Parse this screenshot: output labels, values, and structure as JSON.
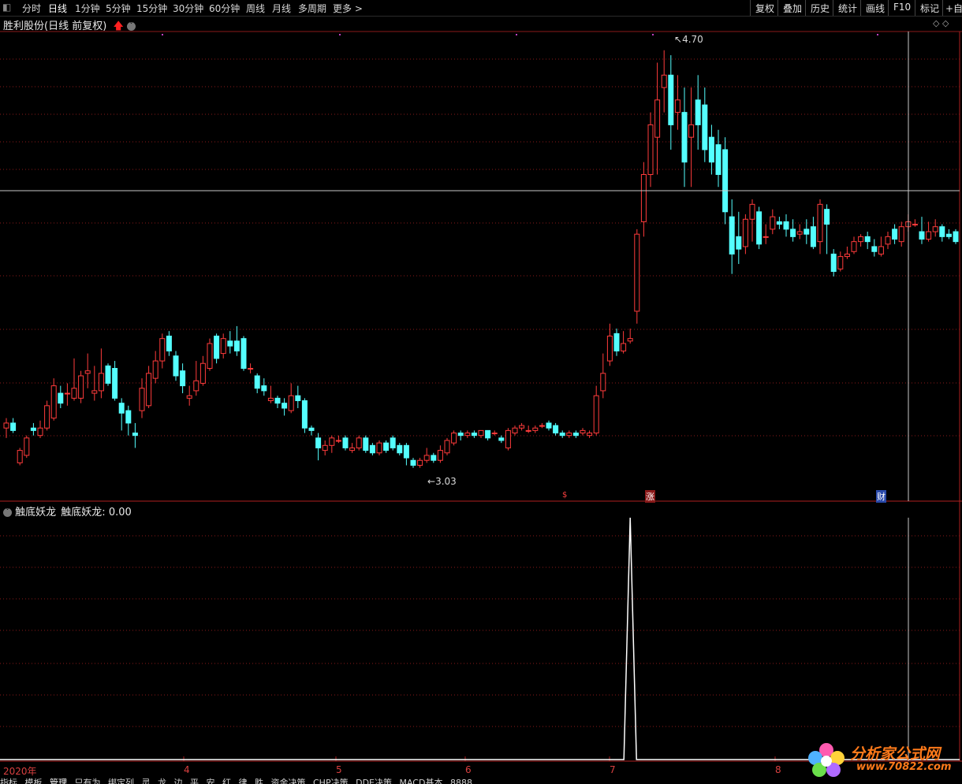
{
  "toolbar": {
    "periods": [
      "分时",
      "日线",
      "1分钟",
      "5分钟",
      "15分钟",
      "30分钟",
      "60分钟",
      "周线",
      "月线",
      "多周期",
      "更多 >"
    ],
    "active_period": "日线",
    "right_buttons": [
      "复权",
      "叠加",
      "历史",
      "统计",
      "画线",
      "F10",
      "标记",
      "+自"
    ]
  },
  "stock": {
    "name": "胜利股份",
    "mode": "(日线 前复权)"
  },
  "price_labels": {
    "high": "4.70",
    "low": "3.03"
  },
  "event_markers": [
    "$",
    "涨",
    "财"
  ],
  "indicator": {
    "title": "触底妖龙",
    "label": "触底妖龙:",
    "value": "0.00"
  },
  "date_axis": [
    "2020年",
    "4",
    "5",
    "6",
    "7",
    "8"
  ],
  "bottom_tabs": [
    "指标",
    "模板",
    "管理",
    "只有为",
    "绑定列",
    "灵",
    "龙",
    "边",
    "平",
    "安",
    "红",
    "律",
    "胜",
    "资金决策",
    "CHP决策",
    "DDE决策",
    "MACD基本",
    "8888"
  ],
  "watermark": {
    "site": "分析家公式网",
    "url": "www.70822.com"
  },
  "colors": {
    "up": "#ff3b3b",
    "down": "#54ffff",
    "grid": "#8a1a1a",
    "text": "#c0c0c0"
  },
  "chart_data": {
    "type": "candlestick",
    "series_name": "胜利股份",
    "ylim": [
      3.0,
      4.75
    ],
    "high_label": 4.7,
    "low_label": 3.03,
    "candles": [
      [
        3.18,
        3.2,
        3.14,
        3.22
      ],
      [
        3.2,
        3.17,
        3.16,
        3.22
      ],
      [
        3.04,
        3.09,
        3.03,
        3.1
      ],
      [
        3.07,
        3.14,
        3.06,
        3.15
      ],
      [
        3.18,
        3.17,
        3.15,
        3.2
      ],
      [
        3.15,
        3.18,
        3.14,
        3.21
      ],
      [
        3.18,
        3.27,
        3.17,
        3.29
      ],
      [
        3.22,
        3.35,
        3.21,
        3.38
      ],
      [
        3.32,
        3.28,
        3.26,
        3.35
      ],
      [
        3.32,
        3.32,
        3.27,
        3.36
      ],
      [
        3.3,
        3.34,
        3.29,
        3.46
      ],
      [
        3.3,
        3.39,
        3.28,
        3.41
      ],
      [
        3.4,
        3.41,
        3.34,
        3.48
      ],
      [
        3.32,
        3.33,
        3.29,
        3.43
      ],
      [
        3.33,
        3.4,
        3.3,
        3.5
      ],
      [
        3.43,
        3.36,
        3.35,
        3.44
      ],
      [
        3.42,
        3.3,
        3.29,
        3.45
      ],
      [
        3.28,
        3.24,
        3.17,
        3.3
      ],
      [
        3.25,
        3.2,
        3.15,
        3.27
      ],
      [
        3.16,
        3.15,
        3.1,
        3.2
      ],
      [
        3.25,
        3.34,
        3.22,
        3.38
      ],
      [
        3.27,
        3.4,
        3.26,
        3.43
      ],
      [
        3.38,
        3.45,
        3.36,
        3.49
      ],
      [
        3.45,
        3.54,
        3.42,
        3.56
      ],
      [
        3.55,
        3.49,
        3.47,
        3.57
      ],
      [
        3.47,
        3.39,
        3.37,
        3.49
      ],
      [
        3.41,
        3.35,
        3.32,
        3.44
      ],
      [
        3.3,
        3.31,
        3.27,
        3.35
      ],
      [
        3.33,
        3.37,
        3.31,
        3.45
      ],
      [
        3.36,
        3.44,
        3.35,
        3.47
      ],
      [
        3.42,
        3.52,
        3.41,
        3.54
      ],
      [
        3.55,
        3.46,
        3.44,
        3.56
      ],
      [
        3.48,
        3.54,
        3.46,
        3.56
      ],
      [
        3.53,
        3.51,
        3.48,
        3.57
      ],
      [
        3.53,
        3.49,
        3.47,
        3.59
      ],
      [
        3.54,
        3.42,
        3.41,
        3.55
      ],
      [
        3.42,
        3.42,
        3.4,
        3.44
      ],
      [
        3.39,
        3.34,
        3.32,
        3.4
      ],
      [
        3.35,
        3.33,
        3.31,
        3.38
      ],
      [
        3.29,
        3.3,
        3.28,
        3.35
      ],
      [
        3.3,
        3.28,
        3.26,
        3.31
      ],
      [
        3.28,
        3.26,
        3.23,
        3.3
      ],
      [
        3.25,
        3.31,
        3.24,
        3.36
      ],
      [
        3.31,
        3.29,
        3.26,
        3.35
      ],
      [
        3.29,
        3.18,
        3.16,
        3.3
      ],
      [
        3.18,
        3.17,
        3.15,
        3.19
      ],
      [
        3.14,
        3.1,
        3.05,
        3.16
      ],
      [
        3.09,
        3.11,
        3.07,
        3.13
      ],
      [
        3.11,
        3.14,
        3.08,
        3.15
      ],
      [
        3.13,
        3.13,
        3.12,
        3.15
      ],
      [
        3.14,
        3.1,
        3.09,
        3.15
      ],
      [
        3.09,
        3.1,
        3.08,
        3.12
      ],
      [
        3.1,
        3.14,
        3.09,
        3.15
      ],
      [
        3.14,
        3.09,
        3.08,
        3.15
      ],
      [
        3.11,
        3.08,
        3.07,
        3.12
      ],
      [
        3.08,
        3.12,
        3.07,
        3.13
      ],
      [
        3.12,
        3.09,
        3.08,
        3.13
      ],
      [
        3.14,
        3.1,
        3.09,
        3.15
      ],
      [
        3.11,
        3.08,
        3.07,
        3.12
      ],
      [
        3.11,
        3.06,
        3.03,
        3.12
      ],
      [
        3.05,
        3.03,
        3.02,
        3.06
      ],
      [
        3.03,
        3.05,
        3.02,
        3.06
      ],
      [
        3.05,
        3.07,
        3.04,
        3.1
      ],
      [
        3.07,
        3.05,
        3.04,
        3.08
      ],
      [
        3.05,
        3.09,
        3.04,
        3.11
      ],
      [
        3.08,
        3.13,
        3.07,
        3.14
      ],
      [
        3.12,
        3.16,
        3.11,
        3.17
      ],
      [
        3.16,
        3.15,
        3.13,
        3.17
      ],
      [
        3.15,
        3.16,
        3.14,
        3.17
      ],
      [
        3.16,
        3.15,
        3.14,
        3.17
      ],
      [
        3.15,
        3.17,
        3.14,
        3.17
      ],
      [
        3.17,
        3.14,
        3.13,
        3.17
      ],
      [
        3.16,
        3.16,
        3.15,
        3.17
      ],
      [
        3.14,
        3.13,
        3.12,
        3.15
      ],
      [
        3.1,
        3.17,
        3.09,
        3.18
      ],
      [
        3.16,
        3.18,
        3.15,
        3.19
      ],
      [
        3.18,
        3.19,
        3.17,
        3.2
      ],
      [
        3.17,
        3.17,
        3.16,
        3.19
      ],
      [
        3.17,
        3.18,
        3.16,
        3.19
      ],
      [
        3.19,
        3.19,
        3.18,
        3.2
      ],
      [
        3.2,
        3.18,
        3.17,
        3.21
      ],
      [
        3.19,
        3.16,
        3.15,
        3.2
      ],
      [
        3.16,
        3.15,
        3.14,
        3.17
      ],
      [
        3.15,
        3.16,
        3.14,
        3.17
      ],
      [
        3.16,
        3.15,
        3.14,
        3.17
      ],
      [
        3.16,
        3.17,
        3.15,
        3.18
      ],
      [
        3.15,
        3.16,
        3.14,
        3.17
      ],
      [
        3.16,
        3.31,
        3.15,
        3.35
      ],
      [
        3.33,
        3.4,
        3.3,
        3.48
      ],
      [
        3.45,
        3.55,
        3.43,
        3.6
      ],
      [
        3.56,
        3.49,
        3.47,
        3.58
      ],
      [
        3.49,
        3.52,
        3.48,
        3.57
      ],
      [
        3.53,
        3.54,
        3.52,
        3.58
      ],
      [
        3.65,
        3.96,
        3.6,
        3.98
      ],
      [
        4.01,
        4.2,
        3.95,
        4.25
      ],
      [
        4.2,
        4.4,
        4.15,
        4.45
      ],
      [
        4.35,
        4.5,
        4.2,
        4.65
      ],
      [
        4.55,
        4.6,
        4.45,
        4.7
      ],
      [
        4.6,
        4.4,
        4.3,
        4.68
      ],
      [
        4.45,
        4.5,
        4.38,
        4.6
      ],
      [
        4.45,
        4.25,
        4.15,
        4.55
      ],
      [
        4.35,
        4.4,
        4.15,
        4.55
      ],
      [
        4.5,
        4.4,
        4.3,
        4.6
      ],
      [
        4.48,
        4.3,
        4.25,
        4.55
      ],
      [
        4.35,
        4.25,
        4.2,
        4.4
      ],
      [
        4.32,
        4.2,
        4.15,
        4.38
      ],
      [
        4.3,
        4.05,
        4.0,
        4.35
      ],
      [
        4.03,
        3.88,
        3.8,
        4.1
      ],
      [
        3.95,
        3.9,
        3.84,
        4.05
      ],
      [
        3.91,
        4.02,
        3.88,
        4.04
      ],
      [
        4.02,
        4.08,
        3.93,
        4.1
      ],
      [
        4.05,
        3.92,
        3.9,
        4.07
      ],
      [
        3.95,
        3.95,
        3.92,
        4.0
      ],
      [
        3.98,
        4.03,
        3.96,
        4.06
      ],
      [
        4.01,
        4.0,
        3.98,
        4.03
      ],
      [
        4.01,
        3.98,
        3.95,
        4.04
      ],
      [
        3.98,
        3.95,
        3.93,
        4.02
      ],
      [
        3.96,
        3.97,
        3.94,
        4.0
      ],
      [
        3.98,
        3.96,
        3.92,
        4.02
      ],
      [
        3.99,
        3.91,
        3.9,
        4.03
      ],
      [
        3.93,
        4.08,
        3.88,
        4.1
      ],
      [
        4.06,
        4.0,
        3.88,
        4.08
      ],
      [
        3.88,
        3.81,
        3.79,
        3.9
      ],
      [
        3.82,
        3.87,
        3.81,
        3.89
      ],
      [
        3.87,
        3.88,
        3.86,
        3.91
      ],
      [
        3.89,
        3.93,
        3.88,
        3.95
      ],
      [
        3.93,
        3.95,
        3.91,
        3.96
      ],
      [
        3.95,
        3.93,
        3.9,
        3.97
      ],
      [
        3.91,
        3.89,
        3.87,
        3.94
      ],
      [
        3.88,
        3.91,
        3.87,
        3.95
      ],
      [
        3.92,
        3.95,
        3.9,
        3.97
      ],
      [
        3.98,
        3.94,
        3.92,
        4.0
      ],
      [
        3.93,
        3.99,
        3.91,
        4.01
      ],
      [
        3.99,
        4.01,
        3.97,
        4.04
      ],
      [
        4.0,
        4.0,
        3.99,
        4.02
      ],
      [
        3.97,
        3.94,
        3.92,
        4.03
      ],
      [
        3.94,
        3.97,
        3.93,
        4.01
      ],
      [
        3.97,
        3.99,
        3.95,
        4.02
      ],
      [
        3.99,
        3.95,
        3.93,
        4.0
      ],
      [
        3.96,
        3.95,
        3.94,
        3.98
      ],
      [
        3.97,
        3.93,
        3.92,
        3.98
      ]
    ],
    "indicator": {
      "name": "触底妖龙",
      "spike_at_candle": 92,
      "spike_value": 1,
      "baseline": 0
    }
  }
}
